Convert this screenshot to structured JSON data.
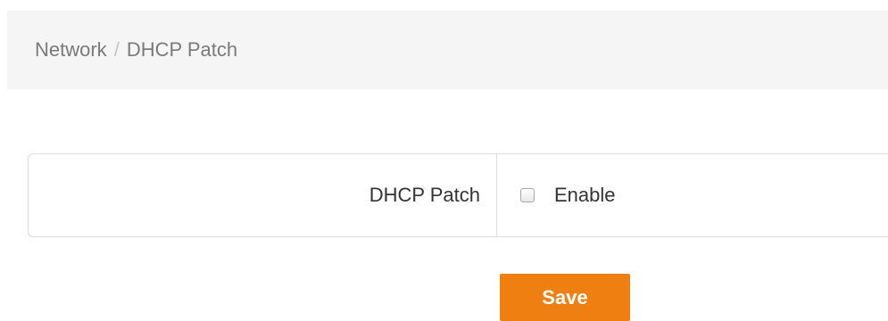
{
  "breadcrumb": {
    "parent": "Network",
    "separator": "/",
    "current": "DHCP Patch"
  },
  "settings": {
    "dhcp_patch_label": "DHCP Patch",
    "enable_label": "Enable",
    "enable_checked": false
  },
  "actions": {
    "save_label": "Save"
  },
  "colors": {
    "accent": "#ee7f10",
    "breadcrumb_bg": "#f5f5f5",
    "border": "#dddddd"
  }
}
